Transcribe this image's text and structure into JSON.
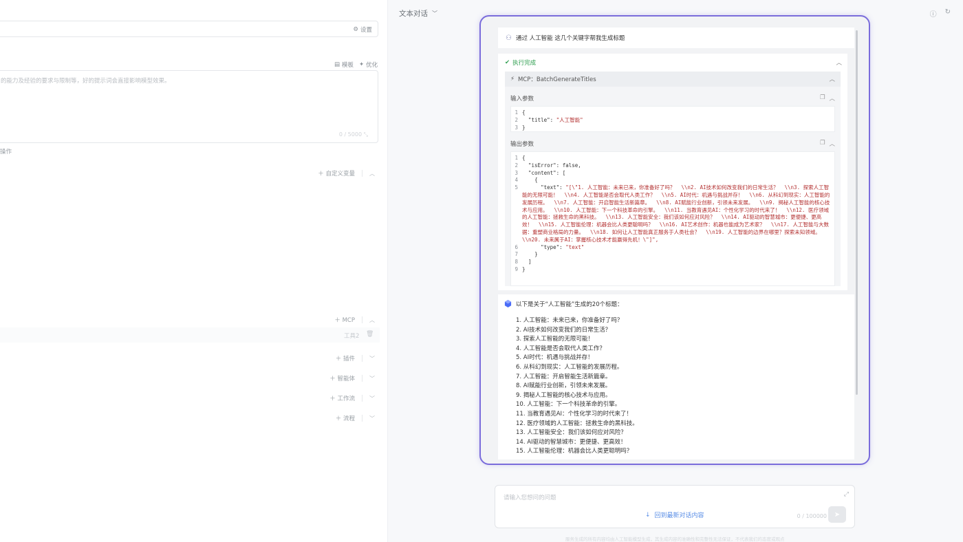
{
  "left": {
    "settings_label": "设置",
    "template_label": "模板",
    "optimize_label": "优化",
    "prompt_text": "的能力及经验的要求与限制等，好的提示词会直接影响模型效果。",
    "prompt_count": "0 / 5000 ⤡",
    "hint_text": "操作",
    "custom_var_label": "自定义变量",
    "mcp_label": "MCP",
    "tool_item_label": "工具2",
    "plugin_label": "插件",
    "agent_label": "智能体",
    "workflow_label": "工作流",
    "flow_label": "流程"
  },
  "right": {
    "conv_title": "文本对话",
    "user_message": "通过 人工智能 这几个关键字帮我生成标题",
    "exec_status": "执行完成",
    "mcp_name": "MCP：BatchGenerateTitles",
    "input_params_label": "输入参数",
    "output_params_label": "输出参数",
    "input_code": [
      {
        "n": "1",
        "t": "{"
      },
      {
        "n": "2",
        "t": "  \"title\": ",
        "s": "\"人工智能\""
      },
      {
        "n": "3",
        "t": "}"
      }
    ],
    "output_code": [
      {
        "n": "1",
        "t": "{"
      },
      {
        "n": "2",
        "t": "  \"isError\": false,"
      },
      {
        "n": "3",
        "t": "  \"content\": ["
      },
      {
        "n": "4",
        "t": "    {"
      },
      {
        "n": "5",
        "t": "      \"text\": ",
        "s": "\"[\\\"1. 人工智能：未来已来，你准备好了吗？  \\\\n2. AI技术如何改变我们的日常生活？  \\\\n3. 探索人工智能的无限可能！  \\\\n4. 人工智能是否会取代人类工作？  \\\\n5. AI时代：机遇与挑战并存！  \\\\n6. 从科幻到现实：人工智能的发展历程。  \\\\n7. 人工智能：开启智能生活新篇章。  \\\\n8. AI赋能行业创新，引领未来发展。  \\\\n9. 揭秘人工智能的核心技术与应用。  \\\\n10. 人工智能：下一个科技革命的引擎。  \\\\n11. 当教育遇见AI：个性化学习的时代来了！  \\\\n12. 医疗领域的人工智能：拯救生命的黑科技。  \\\\n13. 人工智能安全：我们该如何应对风险？  \\\\n14. AI驱动的智慧城市：更便捷、更高效！  \\\\n15. 人工智能伦理：机器会比人类更聪明吗？  \\\\n16. AI艺术创作：机器也能成为艺术家？  \\\\n17. 人工智能与大数据：重塑商业格局的力量。  \\\\n18. 如何让人工智能真正服务于人类社会？  \\\\n19. 人工智能的边界在哪里？探索未知领域。  \\\\n20. 未来属于AI：掌握核心技术才能赢得先机！\\\"]\","
      },
      {
        "n": "6",
        "t": "      \"type\": ",
        "s": "\"text\""
      },
      {
        "n": "7",
        "t": "    }"
      },
      {
        "n": "8",
        "t": "  ]"
      },
      {
        "n": "9",
        "t": "}"
      }
    ],
    "ai_intro": "以下是关于“人工智能”生成的20个标题：",
    "ai_titles": [
      "1. 人工智能：未来已来，你准备好了吗？",
      "2. AI技术如何改变我们的日常生活？",
      "3. 探索人工智能的无限可能！",
      "4. 人工智能是否会取代人类工作？",
      "5. AI时代：机遇与挑战并存！",
      "6. 从科幻到现实：人工智能的发展历程。",
      "7. 人工智能：开启智能生活新篇章。",
      "8. AI赋能行业创新，引领未来发展。",
      "9. 揭秘人工智能的核心技术与应用。",
      "10. 人工智能：下一个科技革命的引擎。",
      "11. 当教育遇见AI：个性化学习的时代来了！",
      "12. 医疗领域的人工智能：拯救生命的黑科技。",
      "13. 人工智能安全：我们该如何应对风险？",
      "14. AI驱动的智慧城市：更便捷、更高效！",
      "15. 人工智能伦理：机器会比人类更聪明吗？"
    ],
    "input_placeholder": "请输入您想问的问题",
    "scroll_latest": "回到最新对话内容",
    "char_count": "0 / 100000",
    "disclaimer": "服务生成的所有内容均由人工智能模型生成，其生成内容的准确性和完整性无法保证，不代表我们的态度或观点"
  },
  "colors": {
    "accent": "#7a6cdb",
    "success": "#2e9e4f",
    "code_string": "#b33030",
    "link": "#5a8ee6"
  }
}
